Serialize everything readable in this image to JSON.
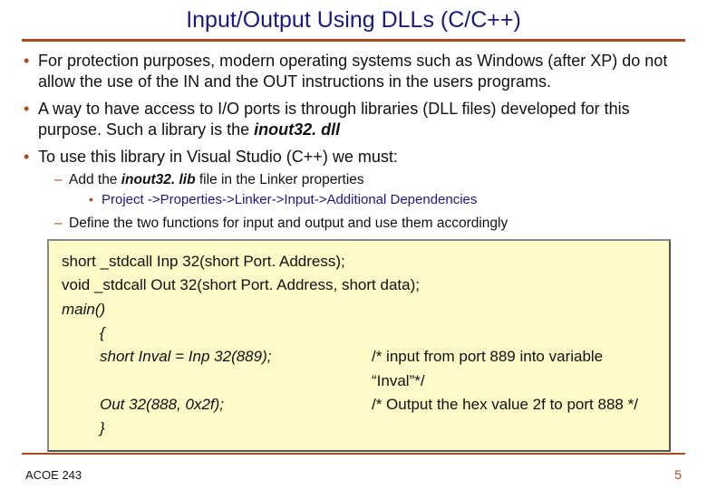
{
  "title": "Input/Output Using DLLs (C/C++)",
  "bullets": {
    "b1": "For protection purposes, modern operating systems such as Windows (after XP) do not allow the use of the IN and the OUT instructions in the users programs.",
    "b2_a": "A way to have access to I/O ports is through libraries (DLL files) developed for this purpose. Such a library is the ",
    "b2_b": "inout32. dll",
    "b3": "To use this library in Visual Studio (C++) we must:",
    "s1_a": "Add the ",
    "s1_b": "inout32. lib",
    "s1_c": " file in the Linker properties",
    "ss1": "Project ->Properties->Linker->Input->Additional Dependencies",
    "s2": "Define the two functions for input and output and use them accordingly"
  },
  "code": {
    "l1": "short _stdcall Inp 32(short Port. Address);",
    "l2": "void _stdcall Out 32(short Port. Address, short data);",
    "l3": "main()",
    "l4": "{",
    "l5a": "short Inval = Inp 32(889);",
    "l5b": "/* input from port 889 into variable “Inval”*/",
    "l6a": "Out 32(888, 0x2f);",
    "l6b": "/* Output the hex value 2f to port 888 */",
    "l7": "}"
  },
  "footer": {
    "left": "ACOE 243",
    "right": "5"
  }
}
